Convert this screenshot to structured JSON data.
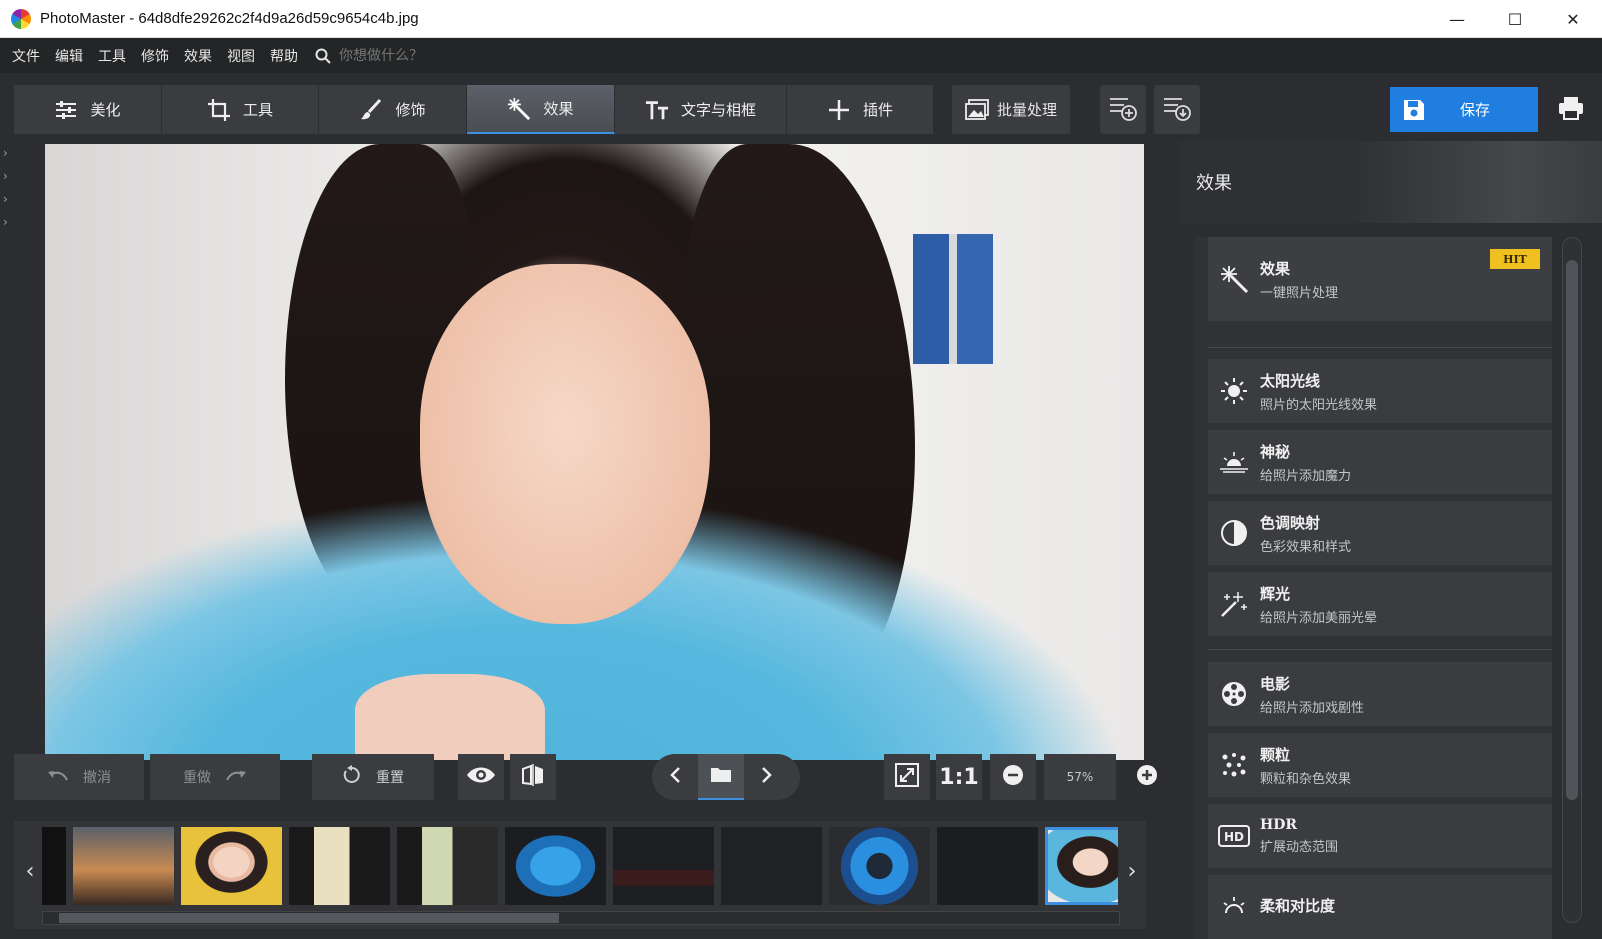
{
  "window": {
    "title": "PhotoMaster - 64d8dfe29262c2f4d9a26d59c9654c4b.jpg",
    "minimize": "—",
    "maximize": "☐",
    "close": "✕"
  },
  "menu": {
    "items": [
      "文件",
      "编辑",
      "工具",
      "修饰",
      "效果",
      "视图",
      "帮助"
    ],
    "search_placeholder": "你想做什么？"
  },
  "toolbar": {
    "tabs": [
      {
        "label": "美化",
        "icon": "sliders-icon"
      },
      {
        "label": "工具",
        "icon": "crop-icon"
      },
      {
        "label": "修饰",
        "icon": "brush-icon"
      },
      {
        "label": "效果",
        "icon": "magic-wand-icon",
        "active": true
      },
      {
        "label": "文字与相框",
        "icon": "text-icon"
      },
      {
        "label": "插件",
        "icon": "plus-icon"
      }
    ],
    "batch_label": "批量处理",
    "save_label": "保存"
  },
  "controls": {
    "undo_label": "撤消",
    "redo_label": "重做",
    "reset_label": "重置",
    "one_to_one": "1:1",
    "zoom": "57%"
  },
  "panel": {
    "title": "效果",
    "items": [
      {
        "title": "效果",
        "subtitle": "一键照片处理",
        "badge": "HIT",
        "icon": "magic-wand-icon"
      },
      {
        "title": "太阳光线",
        "subtitle": "照片的太阳光线效果",
        "icon": "sun-icon"
      },
      {
        "title": "神秘",
        "subtitle": "给照片添加魔力",
        "icon": "sunrise-icon"
      },
      {
        "title": "色调映射",
        "subtitle": "色彩效果和样式",
        "icon": "half-circle-icon"
      },
      {
        "title": "辉光",
        "subtitle": "给照片添加美丽光晕",
        "icon": "sparkle-wand-icon"
      },
      {
        "title": "电影",
        "subtitle": "给照片添加戏剧性",
        "icon": "film-reel-icon"
      },
      {
        "title": "颗粒",
        "subtitle": "颗粒和杂色效果",
        "icon": "grain-dots-icon"
      },
      {
        "title": "HDR",
        "subtitle": "扩展动态范围",
        "icon": "hdr-icon"
      },
      {
        "title": "柔和对比度",
        "subtitle": "",
        "icon": "soft-sun-icon"
      }
    ]
  },
  "colors": {
    "accent": "#1f7ee0",
    "badge": "#f0c020",
    "background": "#2b2d30"
  }
}
